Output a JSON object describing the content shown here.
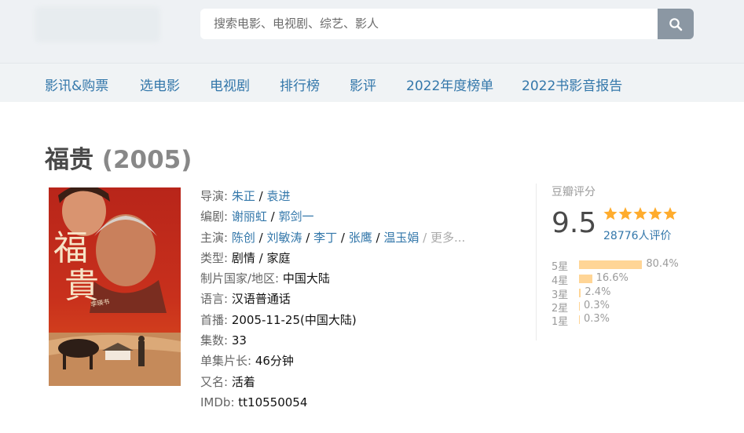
{
  "header": {
    "search_placeholder": "搜索电影、电视剧、综艺、影人",
    "search_icon": "search-icon"
  },
  "nav": {
    "items": [
      "影讯&购票",
      "选电影",
      "电视剧",
      "排行榜",
      "影评",
      "2022年度榜单",
      "2022书影音报告"
    ]
  },
  "subject": {
    "title": "福贵",
    "year": "(2005)"
  },
  "info": {
    "director_label": "导演:",
    "directors": [
      "朱正",
      "袁进"
    ],
    "writer_label": "编剧:",
    "writers": [
      "谢丽虹",
      "郭剑一"
    ],
    "cast_label": "主演:",
    "cast": [
      "陈创",
      "刘敏涛",
      "李丁",
      "张鹰",
      "温玉娟"
    ],
    "cast_more": "更多...",
    "genre_label": "类型:",
    "genres": [
      "剧情",
      "家庭"
    ],
    "country_label": "制片国家/地区:",
    "country": "中国大陆",
    "language_label": "语言:",
    "language": "汉语普通话",
    "premiere_label": "首播:",
    "premiere": "2005-11-25(中国大陆)",
    "episodes_label": "集数:",
    "episodes": "33",
    "runtime_label": "单集片长:",
    "runtime": "46分钟",
    "aka_label": "又名:",
    "aka": "活着",
    "imdb_label": "IMDb:",
    "imdb": "tt10550054"
  },
  "rating": {
    "title": "豆瓣评分",
    "score": "9.5",
    "stars": 5,
    "votes": "28776人评价",
    "distribution": [
      {
        "label": "5星",
        "pct_text": "80.4%",
        "pct": 80.4
      },
      {
        "label": "4星",
        "pct_text": "16.6%",
        "pct": 16.6
      },
      {
        "label": "3星",
        "pct_text": "2.4%",
        "pct": 2.4
      },
      {
        "label": "2星",
        "pct_text": "0.3%",
        "pct": 0.3
      },
      {
        "label": "1星",
        "pct_text": "0.3%",
        "pct": 0.3
      }
    ],
    "star_color": "#ffac2d",
    "bar_color": "#ffd596"
  },
  "poster": {
    "title_chars": [
      "福",
      "貴"
    ],
    "signature": "李瑛书"
  }
}
